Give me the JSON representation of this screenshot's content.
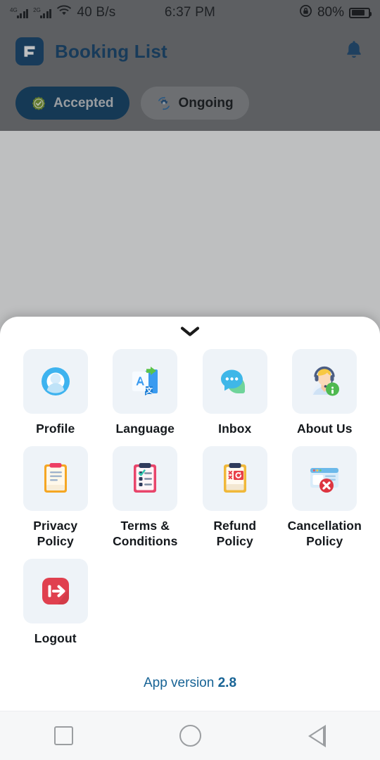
{
  "status_bar": {
    "network_speed": "40 B/s",
    "signal_1_label": "4G",
    "signal_2_label": "2G",
    "wifi_icon": "wifi-icon",
    "time": "6:37 PM",
    "rotation_lock_icon": "rotation-lock-icon",
    "battery_percent": "80%",
    "battery_level": 80
  },
  "header": {
    "logo_icon": "app-logo-icon",
    "title": "Booking List",
    "notification_icon": "bell-icon"
  },
  "filters": [
    {
      "label": "Accepted",
      "icon": "check-seal-icon",
      "selected": true
    },
    {
      "label": "Ongoing",
      "icon": "processing-gear-icon",
      "selected": false
    }
  ],
  "sheet": {
    "handle_icon": "chevron-down-icon",
    "items": [
      {
        "label": "Profile",
        "icon": "user-avatar-icon"
      },
      {
        "label": "Language",
        "icon": "translate-icon"
      },
      {
        "label": "Inbox",
        "icon": "chat-bubbles-icon"
      },
      {
        "label": "About Us",
        "icon": "support-agent-info-icon"
      },
      {
        "label": "Privacy Policy",
        "icon": "clipboard-document-icon"
      },
      {
        "label": "Terms & Conditions",
        "icon": "clipboard-checklist-icon"
      },
      {
        "label": "Refund Policy",
        "icon": "clipboard-refund-icon"
      },
      {
        "label": "Cancellation Policy",
        "icon": "browser-cancel-icon"
      },
      {
        "label": "Logout",
        "icon": "logout-arrow-icon"
      }
    ],
    "version_prefix": "App version",
    "version_number": "2.8"
  },
  "nav_bar": {
    "recents_label": "recents-square",
    "home_label": "home-circle",
    "back_label": "back-triangle"
  },
  "colors": {
    "brand_navy": "#12436e",
    "accent_link": "#176395",
    "tile_bg": "#eef3f8",
    "scrim": "#747679",
    "logout_red": "#e0404f"
  }
}
